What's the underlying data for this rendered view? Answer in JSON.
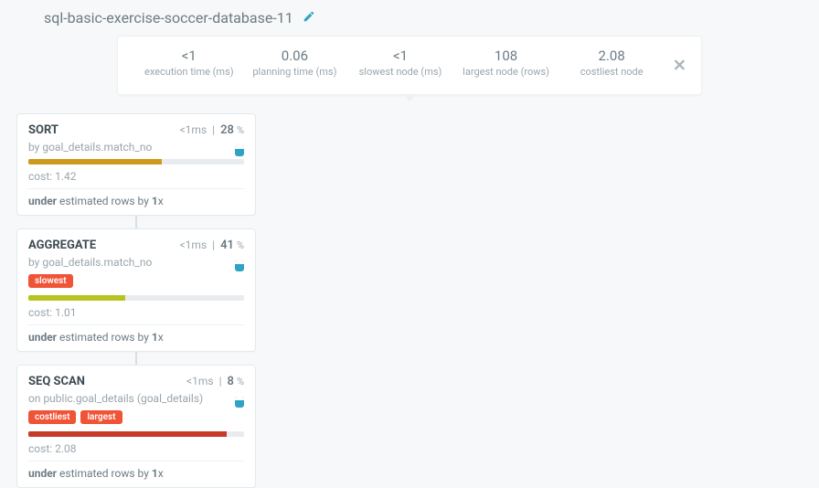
{
  "title": "sql-basic-exercise-soccer-database-11",
  "stats": [
    {
      "value": "<1",
      "label": "execution time (ms)"
    },
    {
      "value": "0.06",
      "label": "planning time (ms)"
    },
    {
      "value": "<1",
      "label": "slowest node (ms)"
    },
    {
      "value": "108",
      "label": "largest node (rows)"
    },
    {
      "value": "2.08",
      "label": "costliest node"
    }
  ],
  "nodes": [
    {
      "op": "SORT",
      "sub_prefix": "by",
      "sub_value": "goal_details.match_no",
      "time": "<1ms",
      "pct": "28",
      "pct_suffix": "%",
      "badges": [],
      "bar_class": "bar-orange",
      "bar_width": "62%",
      "cost_label": "cost:",
      "cost_value": "1.42",
      "est_prefix": "under",
      "est_mid": "estimated rows by",
      "est_factor": "1",
      "est_suffix": "x"
    },
    {
      "op": "AGGREGATE",
      "sub_prefix": "by",
      "sub_value": "goal_details.match_no",
      "time": "<1ms",
      "pct": "41",
      "pct_suffix": "%",
      "badges": [
        "slowest"
      ],
      "bar_class": "bar-olive",
      "bar_width": "45%",
      "cost_label": "cost:",
      "cost_value": "1.01",
      "est_prefix": "under",
      "est_mid": "estimated rows by",
      "est_factor": "1",
      "est_suffix": "x"
    },
    {
      "op": "SEQ SCAN",
      "sub_prefix": "on",
      "sub_value": "public.goal_details (goal_details)",
      "time": "<1ms",
      "pct": "8",
      "pct_suffix": "%",
      "badges": [
        "costliest",
        "largest"
      ],
      "bar_class": "bar-red",
      "bar_width": "92%",
      "cost_label": "cost:",
      "cost_value": "2.08",
      "est_prefix": "under",
      "est_mid": "estimated rows by",
      "est_factor": "1",
      "est_suffix": "x"
    }
  ]
}
